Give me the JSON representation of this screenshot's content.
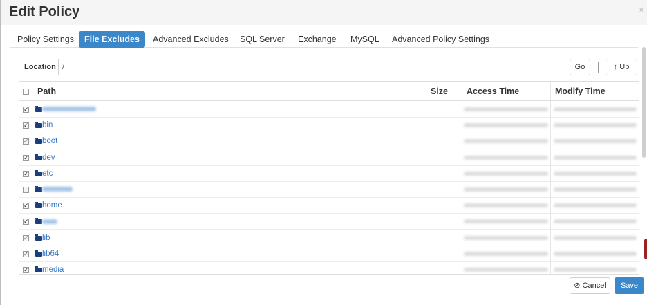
{
  "dialog": {
    "title": "Edit Policy",
    "close_glyph": "×"
  },
  "tabs": [
    {
      "label": "Policy Settings",
      "active": false
    },
    {
      "label": "File Excludes",
      "active": true
    },
    {
      "label": "Advanced Excludes",
      "active": false
    },
    {
      "label": "SQL Server",
      "active": false
    },
    {
      "label": "Exchange",
      "active": false
    },
    {
      "label": "MySQL",
      "active": false
    },
    {
      "label": "Advanced Policy Settings",
      "active": false
    }
  ],
  "location": {
    "label": "Location",
    "value": "/",
    "go_label": "Go",
    "up_label": "Up",
    "up_icon": "↑"
  },
  "table": {
    "columns": [
      "Path",
      "Size",
      "Access Time",
      "Modify Time"
    ],
    "rows": [
      {
        "name": "",
        "checked": true
      },
      {
        "name": "bin",
        "checked": true
      },
      {
        "name": "boot",
        "checked": true
      },
      {
        "name": "dev",
        "checked": true
      },
      {
        "name": "etc",
        "checked": true
      },
      {
        "name": "",
        "checked": false
      },
      {
        "name": "home",
        "checked": true
      },
      {
        "name": "",
        "checked": true
      },
      {
        "name": "lib",
        "checked": true
      },
      {
        "name": "lib64",
        "checked": true
      },
      {
        "name": "media",
        "checked": true
      }
    ]
  },
  "footer": {
    "cancel_label": "Cancel",
    "cancel_icon": "⊘",
    "save_label": "Save"
  },
  "colors": {
    "accent": "#3a87c9",
    "folder": "#1a3f7a",
    "link": "#3a79c6"
  }
}
